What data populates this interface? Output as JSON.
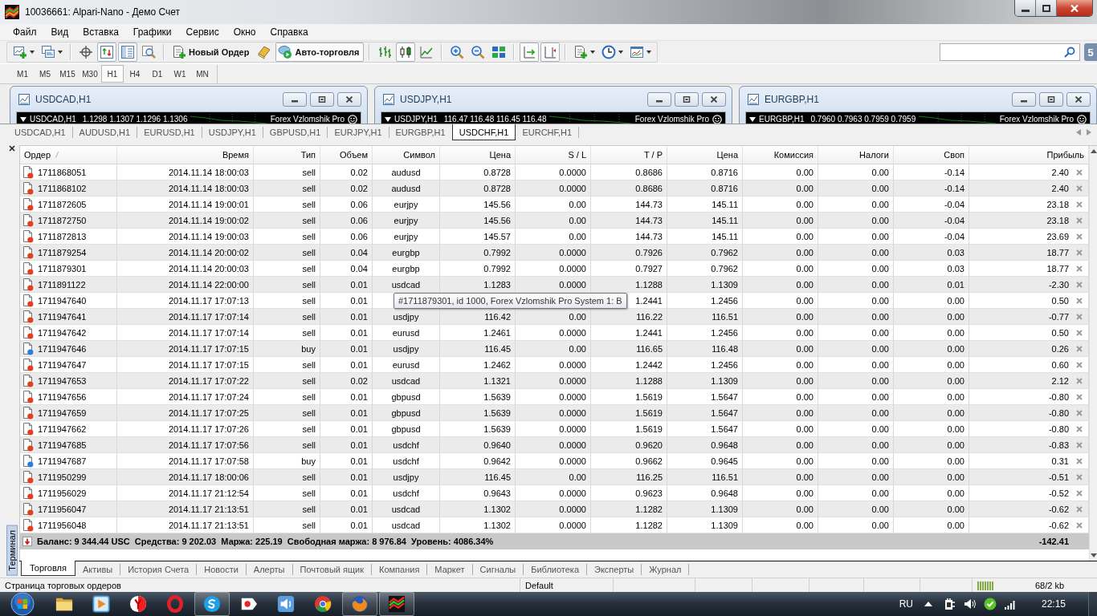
{
  "window": {
    "title": "10036661: Alpari-Nano - Демо Счет"
  },
  "menu": [
    "Файл",
    "Вид",
    "Вставка",
    "Графики",
    "Сервис",
    "Окно",
    "Справка"
  ],
  "toolbar": {
    "groups": [
      [
        {
          "kind": "newchart",
          "pressed": false
        },
        {
          "kind": "profiles",
          "pressed": false
        }
      ],
      [
        {
          "kind": "crosshair",
          "pressed": false
        },
        {
          "kind": "datawindow",
          "pressed": true
        },
        {
          "kind": "navigator",
          "pressed": true
        },
        {
          "kind": "tester",
          "pressed": false
        }
      ],
      [
        {
          "kind": "order",
          "label": "Новый Ордер",
          "pressed": false
        },
        {
          "kind": "editor",
          "pressed": false
        },
        {
          "kind": "autotrading",
          "label": "Авто-торговля",
          "pressed": true
        }
      ],
      [
        {
          "kind": "bars",
          "pressed": false
        },
        {
          "kind": "candles",
          "pressed": true
        },
        {
          "kind": "line",
          "pressed": false
        }
      ],
      [
        {
          "kind": "zoomin",
          "pressed": false
        },
        {
          "kind": "zoomout",
          "pressed": false
        },
        {
          "kind": "tile",
          "pressed": false
        }
      ],
      [
        {
          "kind": "autoscroll",
          "pressed": true
        },
        {
          "kind": "shift",
          "pressed": true
        }
      ],
      [
        {
          "kind": "indicators",
          "pressed": false
        },
        {
          "kind": "periods",
          "pressed": false
        },
        {
          "kind": "templates",
          "pressed": false
        }
      ]
    ]
  },
  "notifications": {
    "count": "5"
  },
  "timeframes": [
    {
      "label": "M1",
      "selected": false
    },
    {
      "label": "M5",
      "selected": false
    },
    {
      "label": "M15",
      "selected": false
    },
    {
      "label": "M30",
      "selected": false
    },
    {
      "label": "H1",
      "selected": true
    },
    {
      "label": "H4",
      "selected": false
    },
    {
      "label": "D1",
      "selected": false
    },
    {
      "label": "W1",
      "selected": false
    },
    {
      "label": "MN",
      "selected": false
    }
  ],
  "charts": [
    {
      "title": "USDCAD,H1",
      "symbol": "USDCAD,H1",
      "quotes": "1.1298 1.1307 1.1296 1.1306",
      "expert": "Forex Vzlomshik Pro"
    },
    {
      "title": "USDJPY,H1",
      "symbol": "USDJPY,H1",
      "quotes": "116.47 116.48 116.45 116.48",
      "expert": "Forex Vzlomshik Pro"
    },
    {
      "title": "EURGBP,H1",
      "symbol": "EURGBP,H1",
      "quotes": "0.7960 0.7963 0.7959 0.7959",
      "expert": "Forex Vzlomshik Pro"
    }
  ],
  "chart_tabs": [
    {
      "label": "USDCAD,H1",
      "selected": false
    },
    {
      "label": "AUDUSD,H1",
      "selected": false
    },
    {
      "label": "EURUSD,H1",
      "selected": false
    },
    {
      "label": "USDJPY,H1",
      "selected": false
    },
    {
      "label": "GBPUSD,H1",
      "selected": false
    },
    {
      "label": "EURJPY,H1",
      "selected": false
    },
    {
      "label": "EURGBP,H1",
      "selected": false
    },
    {
      "label": "USDCHF,H1",
      "selected": true
    },
    {
      "label": "EURCHF,H1",
      "selected": false
    }
  ],
  "terminal": {
    "label": "Терминал",
    "columns": [
      "Ордер",
      "Время",
      "Тип",
      "Объем",
      "Символ",
      "Цена",
      "S / L",
      "T / P",
      "Цена",
      "Комиссия",
      "Налоги",
      "Своп",
      "Прибыль"
    ],
    "rows": [
      {
        "kind": "sell",
        "cells": [
          "1711868051",
          "2014.11.14 18:00:03",
          "sell",
          "0.02",
          "audusd",
          "0.8728",
          "0.0000",
          "0.8686",
          "0.8716",
          "0.00",
          "0.00",
          "-0.14",
          "2.40"
        ]
      },
      {
        "kind": "sell",
        "cells": [
          "1711868102",
          "2014.11.14 18:00:03",
          "sell",
          "0.02",
          "audusd",
          "0.8728",
          "0.0000",
          "0.8686",
          "0.8716",
          "0.00",
          "0.00",
          "-0.14",
          "2.40"
        ]
      },
      {
        "kind": "sell",
        "cells": [
          "1711872605",
          "2014.11.14 19:00:01",
          "sell",
          "0.06",
          "eurjpy",
          "145.56",
          "0.00",
          "144.73",
          "145.11",
          "0.00",
          "0.00",
          "-0.04",
          "23.18"
        ]
      },
      {
        "kind": "sell",
        "cells": [
          "1711872750",
          "2014.11.14 19:00:02",
          "sell",
          "0.06",
          "eurjpy",
          "145.56",
          "0.00",
          "144.73",
          "145.11",
          "0.00",
          "0.00",
          "-0.04",
          "23.18"
        ]
      },
      {
        "kind": "sell",
        "cells": [
          "1711872813",
          "2014.11.14 19:00:03",
          "sell",
          "0.06",
          "eurjpy",
          "145.57",
          "0.00",
          "144.73",
          "145.11",
          "0.00",
          "0.00",
          "-0.04",
          "23.69"
        ]
      },
      {
        "kind": "sell",
        "cells": [
          "1711879254",
          "2014.11.14 20:00:02",
          "sell",
          "0.04",
          "eurgbp",
          "0.7992",
          "0.0000",
          "0.7926",
          "0.7962",
          "0.00",
          "0.00",
          "0.03",
          "18.77"
        ]
      },
      {
        "kind": "sell",
        "cells": [
          "1711879301",
          "2014.11.14 20:00:03",
          "sell",
          "0.04",
          "eurgbp",
          "0.7992",
          "0.0000",
          "0.7927",
          "0.7962",
          "0.00",
          "0.00",
          "0.03",
          "18.77"
        ]
      },
      {
        "kind": "sell",
        "cells": [
          "1711891122",
          "2014.11.14 22:00:00",
          "sell",
          "0.01",
          "usdcad",
          "1.1283",
          "0.0000",
          "1.1288",
          "1.1309",
          "0.00",
          "0.00",
          "0.01",
          "-2.30"
        ]
      },
      {
        "kind": "sell",
        "cells": [
          "1711947640",
          "2014.11.17 17:07:13",
          "sell",
          "0.01",
          null,
          null,
          null,
          "1.2441",
          "1.2456",
          "0.00",
          "0.00",
          "0.00",
          "0.50"
        ]
      },
      {
        "kind": "sell",
        "cells": [
          "1711947641",
          "2014.11.17 17:07:14",
          "sell",
          "0.01",
          "usdjpy",
          "116.42",
          "0.00",
          "116.22",
          "116.51",
          "0.00",
          "0.00",
          "0.00",
          "-0.77"
        ]
      },
      {
        "kind": "sell",
        "cells": [
          "1711947642",
          "2014.11.17 17:07:14",
          "sell",
          "0.01",
          "eurusd",
          "1.2461",
          "0.0000",
          "1.2441",
          "1.2456",
          "0.00",
          "0.00",
          "0.00",
          "0.50"
        ]
      },
      {
        "kind": "buy",
        "cells": [
          "1711947646",
          "2014.11.17 17:07:15",
          "buy",
          "0.01",
          "usdjpy",
          "116.45",
          "0.00",
          "116.65",
          "116.48",
          "0.00",
          "0.00",
          "0.00",
          "0.26"
        ]
      },
      {
        "kind": "sell",
        "cells": [
          "1711947647",
          "2014.11.17 17:07:15",
          "sell",
          "0.01",
          "eurusd",
          "1.2462",
          "0.0000",
          "1.2442",
          "1.2456",
          "0.00",
          "0.00",
          "0.00",
          "0.60"
        ]
      },
      {
        "kind": "sell",
        "cells": [
          "1711947653",
          "2014.11.17 17:07:22",
          "sell",
          "0.02",
          "usdcad",
          "1.1321",
          "0.0000",
          "1.1288",
          "1.1309",
          "0.00",
          "0.00",
          "0.00",
          "2.12"
        ]
      },
      {
        "kind": "sell",
        "cells": [
          "1711947656",
          "2014.11.17 17:07:24",
          "sell",
          "0.01",
          "gbpusd",
          "1.5639",
          "0.0000",
          "1.5619",
          "1.5647",
          "0.00",
          "0.00",
          "0.00",
          "-0.80"
        ]
      },
      {
        "kind": "sell",
        "cells": [
          "1711947659",
          "2014.11.17 17:07:25",
          "sell",
          "0.01",
          "gbpusd",
          "1.5639",
          "0.0000",
          "1.5619",
          "1.5647",
          "0.00",
          "0.00",
          "0.00",
          "-0.80"
        ]
      },
      {
        "kind": "sell",
        "cells": [
          "1711947662",
          "2014.11.17 17:07:26",
          "sell",
          "0.01",
          "gbpusd",
          "1.5639",
          "0.0000",
          "1.5619",
          "1.5647",
          "0.00",
          "0.00",
          "0.00",
          "-0.80"
        ]
      },
      {
        "kind": "sell",
        "cells": [
          "1711947685",
          "2014.11.17 17:07:56",
          "sell",
          "0.01",
          "usdchf",
          "0.9640",
          "0.0000",
          "0.9620",
          "0.9648",
          "0.00",
          "0.00",
          "0.00",
          "-0.83"
        ]
      },
      {
        "kind": "buy",
        "cells": [
          "1711947687",
          "2014.11.17 17:07:58",
          "buy",
          "0.01",
          "usdchf",
          "0.9642",
          "0.0000",
          "0.9662",
          "0.9645",
          "0.00",
          "0.00",
          "0.00",
          "0.31"
        ]
      },
      {
        "kind": "sell",
        "cells": [
          "1711950299",
          "2014.11.17 18:00:06",
          "sell",
          "0.01",
          "usdjpy",
          "116.45",
          "0.00",
          "116.25",
          "116.51",
          "0.00",
          "0.00",
          "0.00",
          "-0.51"
        ]
      },
      {
        "kind": "sell",
        "cells": [
          "1711956029",
          "2014.11.17 21:12:54",
          "sell",
          "0.01",
          "usdchf",
          "0.9643",
          "0.0000",
          "0.9623",
          "0.9648",
          "0.00",
          "0.00",
          "0.00",
          "-0.52"
        ]
      },
      {
        "kind": "sell",
        "cells": [
          "1711956047",
          "2014.11.17 21:13:51",
          "sell",
          "0.01",
          "usdcad",
          "1.1302",
          "0.0000",
          "1.1282",
          "1.1309",
          "0.00",
          "0.00",
          "0.00",
          "-0.62"
        ]
      },
      {
        "kind": "sell",
        "cells": [
          "1711956048",
          "2014.11.17 21:13:51",
          "sell",
          "0.01",
          "usdcad",
          "1.1302",
          "0.0000",
          "1.1282",
          "1.1309",
          "0.00",
          "0.00",
          "0.00",
          "-0.62"
        ]
      }
    ],
    "summary": {
      "text": "Баланс: 9 344.44 USC  Средства: 9 202.03  Маржа: 225.19  Свободная маржа: 8 976.84  Уровень: 4086.34%",
      "profit": "-142.41"
    },
    "tooltip": "#1711879301, id 1000, Forex Vzlomshik Pro System 1: B",
    "tabs": [
      {
        "label": "Торговля",
        "selected": true
      },
      {
        "label": "Активы",
        "selected": false
      },
      {
        "label": "История Счета",
        "selected": false
      },
      {
        "label": "Новости",
        "selected": false
      },
      {
        "label": "Алерты",
        "selected": false
      },
      {
        "label": "Почтовый ящик",
        "selected": false
      },
      {
        "label": "Компания",
        "selected": false
      },
      {
        "label": "Маркет",
        "selected": false
      },
      {
        "label": "Сигналы",
        "selected": false
      },
      {
        "label": "Библиотека",
        "selected": false
      },
      {
        "label": "Эксперты",
        "selected": false
      },
      {
        "label": "Журнал",
        "selected": false
      }
    ]
  },
  "status_bar": {
    "text": "Страница торговых ордеров",
    "profile": "Default",
    "traffic": "68/2 kb"
  },
  "taskbar": {
    "apps": [
      {
        "kind": "folder",
        "active": false
      },
      {
        "kind": "player",
        "active": false
      },
      {
        "kind": "ybrowser",
        "active": false
      },
      {
        "kind": "opera",
        "active": false
      },
      {
        "kind": "skype",
        "active": true
      },
      {
        "kind": "yandex",
        "active": false
      },
      {
        "kind": "speakerapp",
        "active": false
      },
      {
        "kind": "chrome",
        "active": false
      },
      {
        "kind": "firefox",
        "active": true
      },
      {
        "kind": "terminal",
        "active": true
      }
    ],
    "language": "RU",
    "clock": "22:15"
  }
}
